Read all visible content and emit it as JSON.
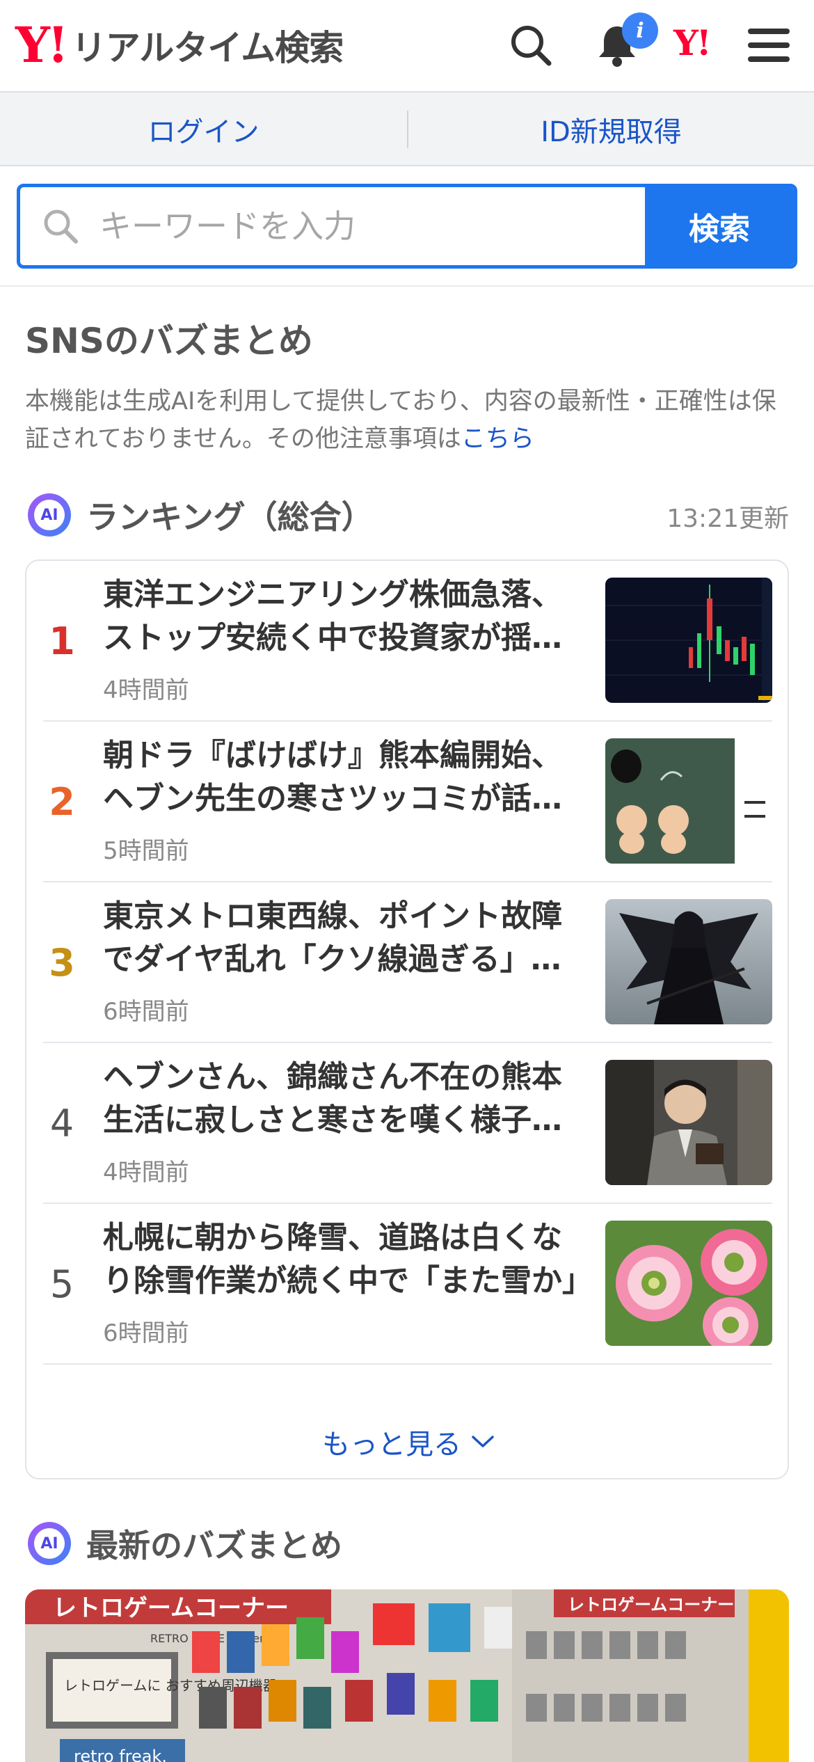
{
  "header": {
    "logo_mark": "Y!",
    "logo_text": "リアルタイム検索",
    "notification_badge": "i",
    "yahoo_mark": "Y!"
  },
  "login_bar": {
    "login": "ログイン",
    "register": "ID新規取得"
  },
  "search": {
    "placeholder": "キーワードを入力",
    "button": "検索"
  },
  "sns": {
    "title": "SNSのバズまとめ",
    "disclaimer": "本機能は生成AIを利用して提供しており、内容の最新性・正確性は保証されておりません。その他注意事項は",
    "disclaimer_link": "こちら"
  },
  "ranking": {
    "ai_label": "AI",
    "title": "ランキング（総合）",
    "updated": "13:21更新",
    "items": [
      {
        "rank": "1",
        "title": "東洋エンジニアリング株価急落、ストップ安続く中で投資家が揺れる",
        "time": "4時間前",
        "color": "#d9302c",
        "thumb": "stock-chart"
      },
      {
        "rank": "2",
        "title": "朝ドラ『ばけばけ』熊本編開始、ヘブン先生の寒さツッコミが話題に",
        "time": "5時間前",
        "color": "#e8632b",
        "thumb": "illustration"
      },
      {
        "rank": "3",
        "title": "東京メトロ東西線、ポイント故障でダイヤ乱れ「クソ線過ぎる」との声",
        "time": "6時間前",
        "color": "#c49016",
        "thumb": "anime-character"
      },
      {
        "rank": "4",
        "title": "ヘブンさん、錦織さん不在の熊本生活に寂しさと寒さを嘆く様子が話題",
        "time": "4時間前",
        "color": "#555555",
        "thumb": "man-portrait"
      },
      {
        "rank": "5",
        "title": "札幌に朝から降雪、道路は白くなり除雪作業が続く中で「また雪か」",
        "time": "6時間前",
        "color": "#555555",
        "thumb": "flowers"
      }
    ],
    "more": "もっと見る"
  },
  "latest": {
    "ai_label": "AI",
    "title": "最新のバズまとめ",
    "image_text_left": "レトロゲームコーナー",
    "image_text_sub": "RETRO GAME corner",
    "image_text_right": "レトロゲームコーナー",
    "image_sign": "レトロゲームに おすすめ周辺機器",
    "image_brand": "retro freak."
  }
}
